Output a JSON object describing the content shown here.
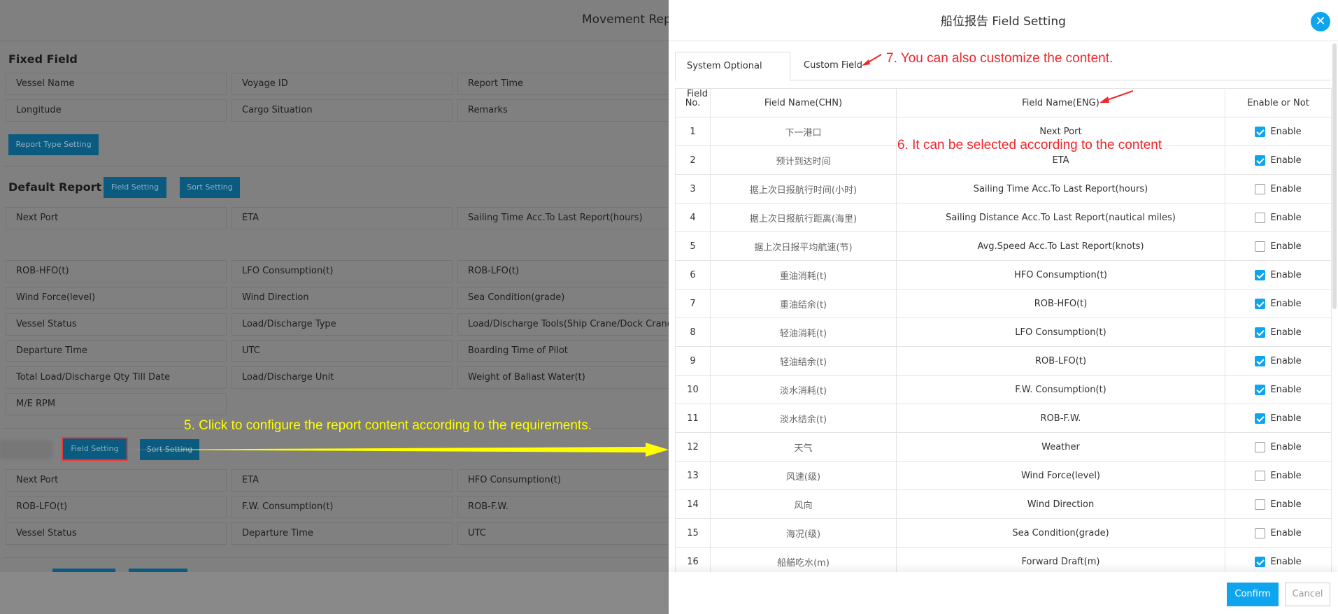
{
  "background_page": {
    "title": "Movement Repo",
    "fixed_field": {
      "heading": "Fixed Field",
      "fields": [
        "Vessel Name",
        "Voyage ID",
        "Report Time",
        "Longitude",
        "Cargo Situation",
        "Remarks"
      ],
      "report_type_button": "Report Type Setting"
    },
    "default_report": {
      "heading": "Default Report",
      "field_setting_button": "Field Setting",
      "sort_setting_button": "Sort Setting",
      "fields_row1": [
        "Next Port",
        "ETA",
        "Sailing Time Acc.To Last Report(hours)"
      ],
      "fields_rest": [
        "ROB-HFO(t)",
        "LFO Consumption(t)",
        "ROB-LFO(t)",
        "Wind Force(level)",
        "Wind Direction",
        "Sea Condition(grade)",
        "Vessel Status",
        "Load/Discharge Type",
        "Load/Discharge Tools(Ship Crane/Dock Crane)",
        "Departure Time",
        "UTC",
        "Boarding Time of Pilot",
        "Total Load/Discharge Qty Till Date",
        "Load/Discharge Unit",
        "Weight of Ballast Water(t)",
        "M/E RPM"
      ]
    },
    "second_report": {
      "field_setting_button": "Field Setting",
      "sort_setting_button": "Sort Setting",
      "fields": [
        "Next Port",
        "ETA",
        "HFO Consumption(t)",
        "ROB-LFO(t)",
        "F.W. Consumption(t)",
        "ROB-F.W.",
        "Vessel Status",
        "Departure Time",
        "UTC"
      ]
    }
  },
  "dialog": {
    "title": "船位报告 Field Setting",
    "close_icon": "close-icon",
    "tabs": [
      {
        "label": "System Optional Field",
        "active": true
      },
      {
        "label": "Custom Field",
        "active": false
      }
    ],
    "columns": [
      "No.",
      "Field Name(CHN)",
      "Field Name(ENG)",
      "Enable or Not"
    ],
    "enable_label": "Enable",
    "rows": [
      {
        "no": "1",
        "chn": "下一港口",
        "eng": "Next Port",
        "enabled": true
      },
      {
        "no": "2",
        "chn": "预计到达时间",
        "eng": "ETA",
        "enabled": true
      },
      {
        "no": "3",
        "chn": "据上次日报航行时间(小时)",
        "eng": "Sailing Time Acc.To Last Report(hours)",
        "enabled": false
      },
      {
        "no": "4",
        "chn": "据上次日报航行距离(海里)",
        "eng": "Sailing Distance Acc.To Last Report(nautical miles)",
        "enabled": false
      },
      {
        "no": "5",
        "chn": "据上次日报平均航速(节)",
        "eng": "Avg.Speed Acc.To Last Report(knots)",
        "enabled": false
      },
      {
        "no": "6",
        "chn": "重油消耗(t)",
        "eng": "HFO Consumption(t)",
        "enabled": true
      },
      {
        "no": "7",
        "chn": "重油结余(t)",
        "eng": "ROB-HFO(t)",
        "enabled": true
      },
      {
        "no": "8",
        "chn": "轻油消耗(t)",
        "eng": "LFO Consumption(t)",
        "enabled": true
      },
      {
        "no": "9",
        "chn": "轻油结余(t)",
        "eng": "ROB-LFO(t)",
        "enabled": true
      },
      {
        "no": "10",
        "chn": "淡水消耗(t)",
        "eng": "F.W. Consumption(t)",
        "enabled": true
      },
      {
        "no": "11",
        "chn": "淡水结余(t)",
        "eng": "ROB-F.W.",
        "enabled": true
      },
      {
        "no": "12",
        "chn": "天气",
        "eng": "Weather",
        "enabled": false
      },
      {
        "no": "13",
        "chn": "风速(级)",
        "eng": "Wind Force(level)",
        "enabled": false
      },
      {
        "no": "14",
        "chn": "风向",
        "eng": "Wind Direction",
        "enabled": false
      },
      {
        "no": "15",
        "chn": "海况(级)",
        "eng": "Sea Condition(grade)",
        "enabled": false
      },
      {
        "no": "16",
        "chn": "船艏吃水(m)",
        "eng": "Forward Draft(m)",
        "enabled": true
      }
    ],
    "confirm_button": "Confirm",
    "cancel_button": "Cancel"
  },
  "annotations": {
    "step5": "5. Click to configure the report content according to the requirements.",
    "step6": "6. It can be selected according to the content",
    "step7": "7. You can also customize the content."
  },
  "colors": {
    "accent": "#0ea5ee",
    "annotation_red": "#f0262b",
    "annotation_yellow": "#ffff00"
  }
}
